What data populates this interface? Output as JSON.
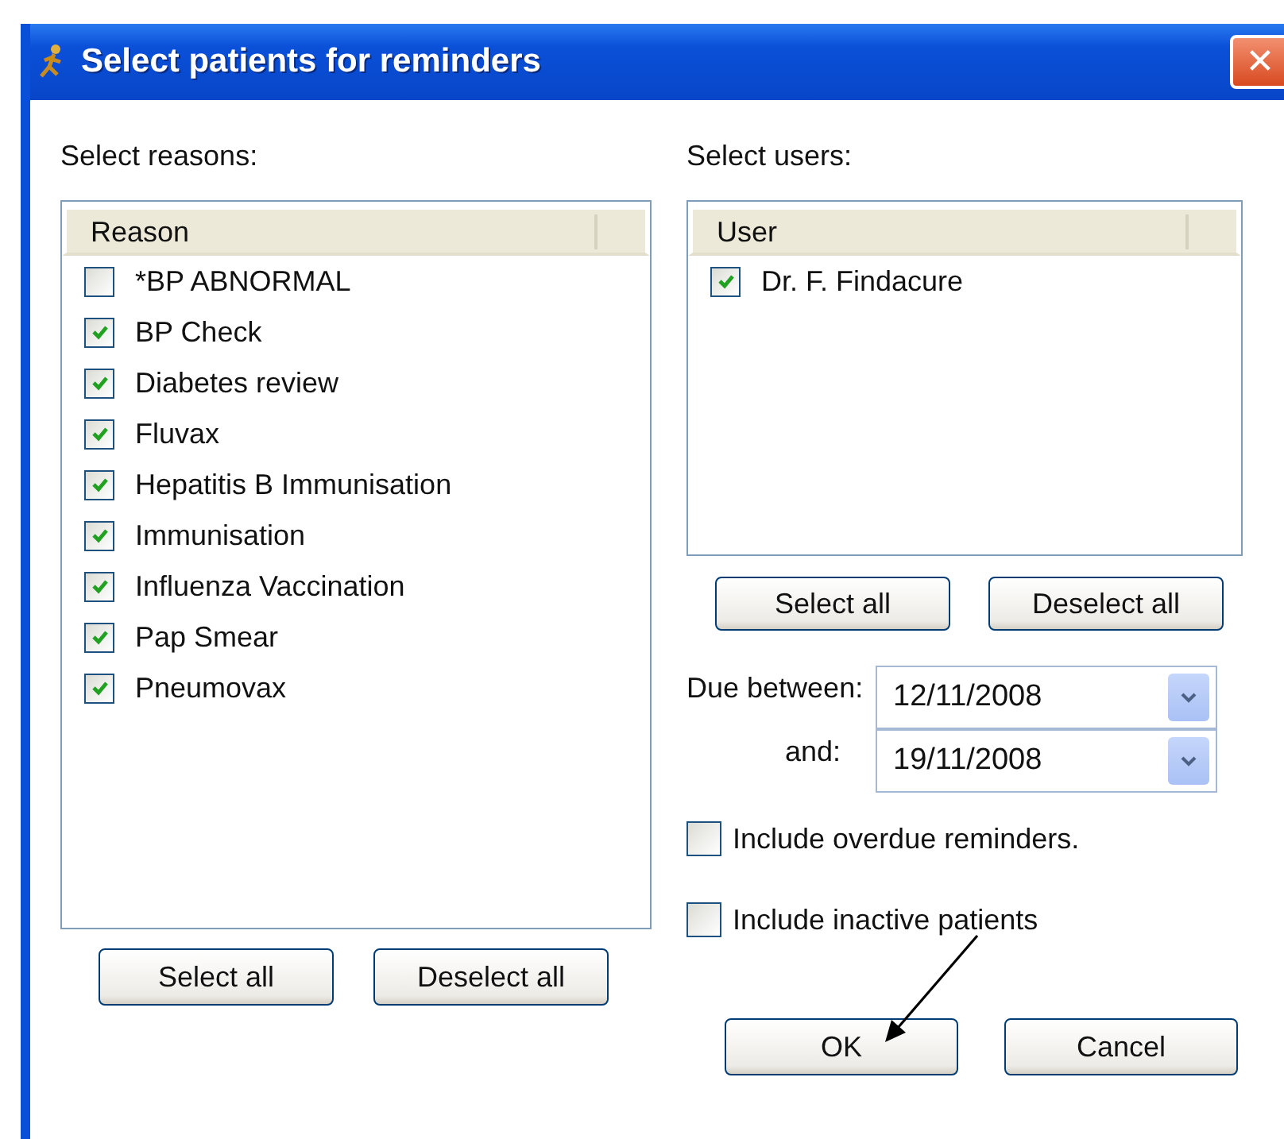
{
  "window": {
    "title": "Select patients for reminders",
    "close": "✕"
  },
  "reasons": {
    "label": "Select reasons:",
    "column": "Reason",
    "items": [
      {
        "label": "*BP ABNORMAL",
        "checked": false
      },
      {
        "label": "BP Check",
        "checked": true
      },
      {
        "label": "Diabetes review",
        "checked": true
      },
      {
        "label": "Fluvax",
        "checked": true
      },
      {
        "label": "Hepatitis B Immunisation",
        "checked": true
      },
      {
        "label": "Immunisation",
        "checked": true
      },
      {
        "label": "Influenza Vaccination",
        "checked": true
      },
      {
        "label": "Pap Smear",
        "checked": true
      },
      {
        "label": "Pneumovax",
        "checked": true
      }
    ],
    "buttons": [
      "Select all",
      "Deselect all"
    ]
  },
  "users": {
    "label": "Select users:",
    "column": "User",
    "items": [
      {
        "label": "Dr. F. Findacure",
        "checked": true
      }
    ],
    "buttons": [
      "Select all",
      "Deselect all"
    ]
  },
  "due": {
    "label": "Due between:",
    "from": "12/11/2008",
    "and_label": "and:",
    "to": "19/11/2008"
  },
  "options": [
    {
      "label": "Include overdue reminders.",
      "checked": false
    },
    {
      "label": "Include inactive patients",
      "checked": false
    }
  ],
  "buttons": [
    "OK",
    "Cancel"
  ]
}
